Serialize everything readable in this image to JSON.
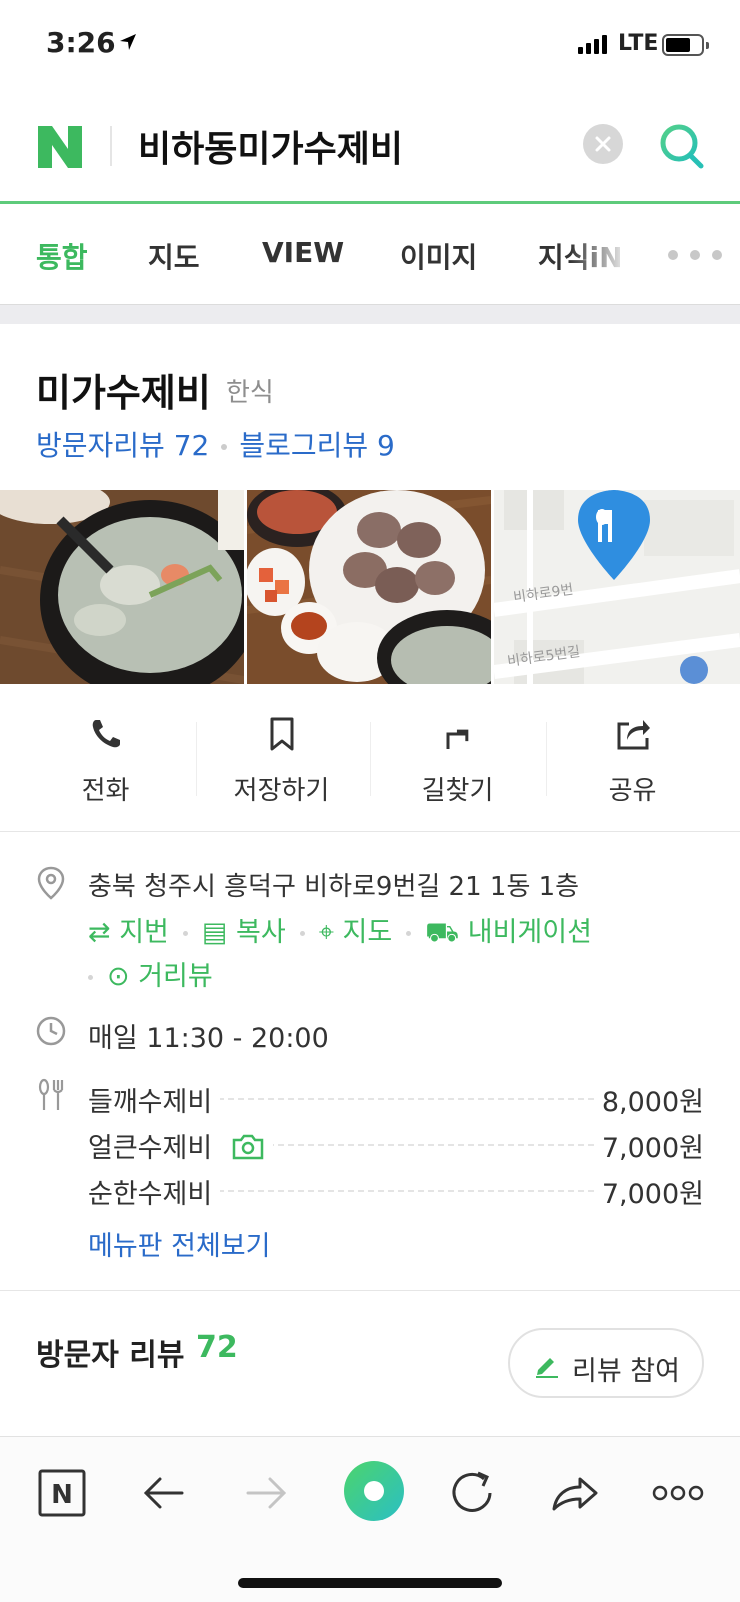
{
  "status": {
    "time": "3:26",
    "network": "LTE"
  },
  "search": {
    "query": "비하동미가수제비"
  },
  "tabs": [
    {
      "label": "통합"
    },
    {
      "label": "지도"
    },
    {
      "label": "VIEW"
    },
    {
      "label": "이미지"
    },
    {
      "label": "지식iN"
    }
  ],
  "place": {
    "name": "미가수제비",
    "category": "한식",
    "visitor_reviews": "방문자리뷰 72",
    "blog_reviews": "블로그리뷰 9"
  },
  "map_thumb": {
    "road1": "비하로9번",
    "road2": "비하로5번길"
  },
  "actions": [
    {
      "label": "전화",
      "icon": "phone-icon"
    },
    {
      "label": "저장하기",
      "icon": "bookmark-icon"
    },
    {
      "label": "길찾기",
      "icon": "directions-icon"
    },
    {
      "label": "공유",
      "icon": "share-icon"
    }
  ],
  "info": {
    "address": "충북 청주시 흥덕구 비하로9번길 21 1동 1층",
    "links": [
      "지번",
      "복사",
      "지도",
      "내비게이션",
      "거리뷰"
    ],
    "hours": "매일 11:30 - 20:00",
    "menu": [
      {
        "name": "들깨수제비",
        "price": "8,000원"
      },
      {
        "name": "얼큰수제비",
        "price": "7,000원"
      },
      {
        "name": "순한수제비",
        "price": "7,000원"
      }
    ],
    "menu_all": "메뉴판 전체보기"
  },
  "reviews": {
    "title": "방문자 리뷰",
    "count": "72",
    "button": "리뷰 참여"
  },
  "colors": {
    "accent": "#3db95f",
    "link": "#2a6bc9",
    "brand": "#03c75a"
  }
}
